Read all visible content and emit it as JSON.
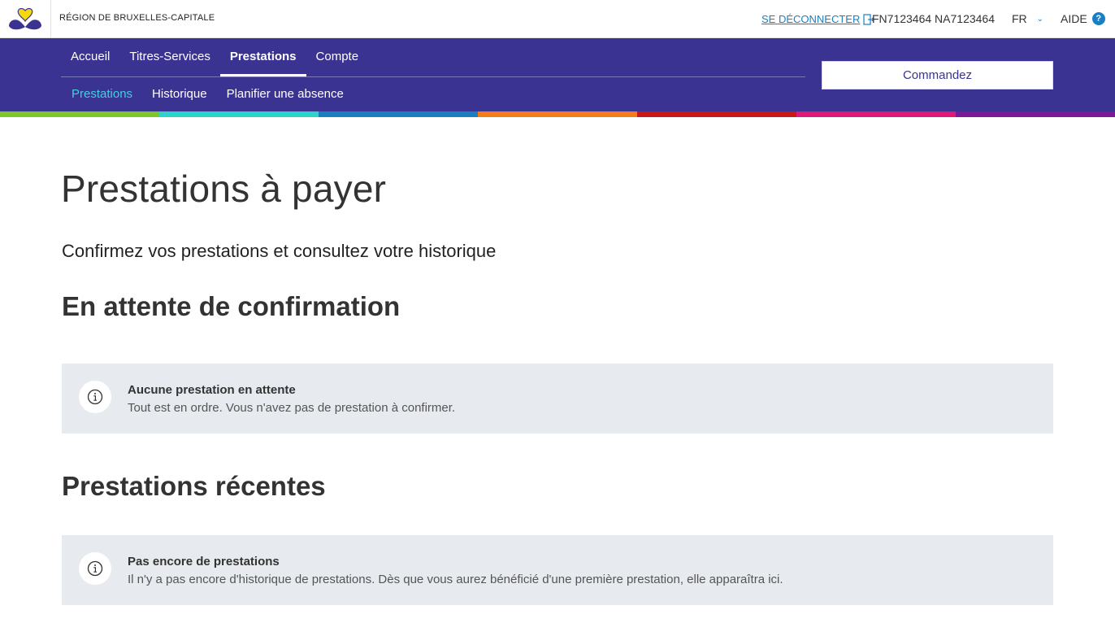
{
  "header": {
    "region": "RÉGION DE BRUXELLES-CAPITALE",
    "logout": "SE DÉCONNECTER",
    "user_id": "FN7123464 NA7123464",
    "language": "FR",
    "help": "AIDE",
    "help_badge": "?"
  },
  "nav": {
    "main": [
      "Accueil",
      "Titres-Services",
      "Prestations",
      "Compte"
    ],
    "active_main": "Prestations",
    "sub": [
      "Prestations",
      "Historique",
      "Planifier une absence"
    ],
    "active_sub": "Prestations",
    "order_button": "Commandez"
  },
  "stripe_colors": [
    "#7cc62a",
    "#2ad4c8",
    "#1a7fc1",
    "#f57a1a",
    "#c81818",
    "#e0187a",
    "#7a1a96"
  ],
  "colors": {
    "brand": "#3b3391",
    "link": "#1a7fc1",
    "active_subnav": "#3fd0e0",
    "notice_bg": "#e7eaee"
  },
  "page": {
    "title": "Prestations à payer",
    "lead": "Confirmez vos prestations et consultez votre historique"
  },
  "sections": {
    "pending": {
      "heading": "En attente de confirmation",
      "notice_icon": "info-icon",
      "notice_title": "Aucune prestation en attente",
      "notice_text": "Tout est en ordre. Vous n'avez pas de prestation à confirmer."
    },
    "recent": {
      "heading": "Prestations récentes",
      "notice_icon": "info-icon",
      "notice_title": "Pas encore de prestations",
      "notice_text": "Il n'y a pas encore d'historique de prestations. Dès que vous aurez bénéficié d'une première prestation, elle apparaîtra ici."
    }
  }
}
